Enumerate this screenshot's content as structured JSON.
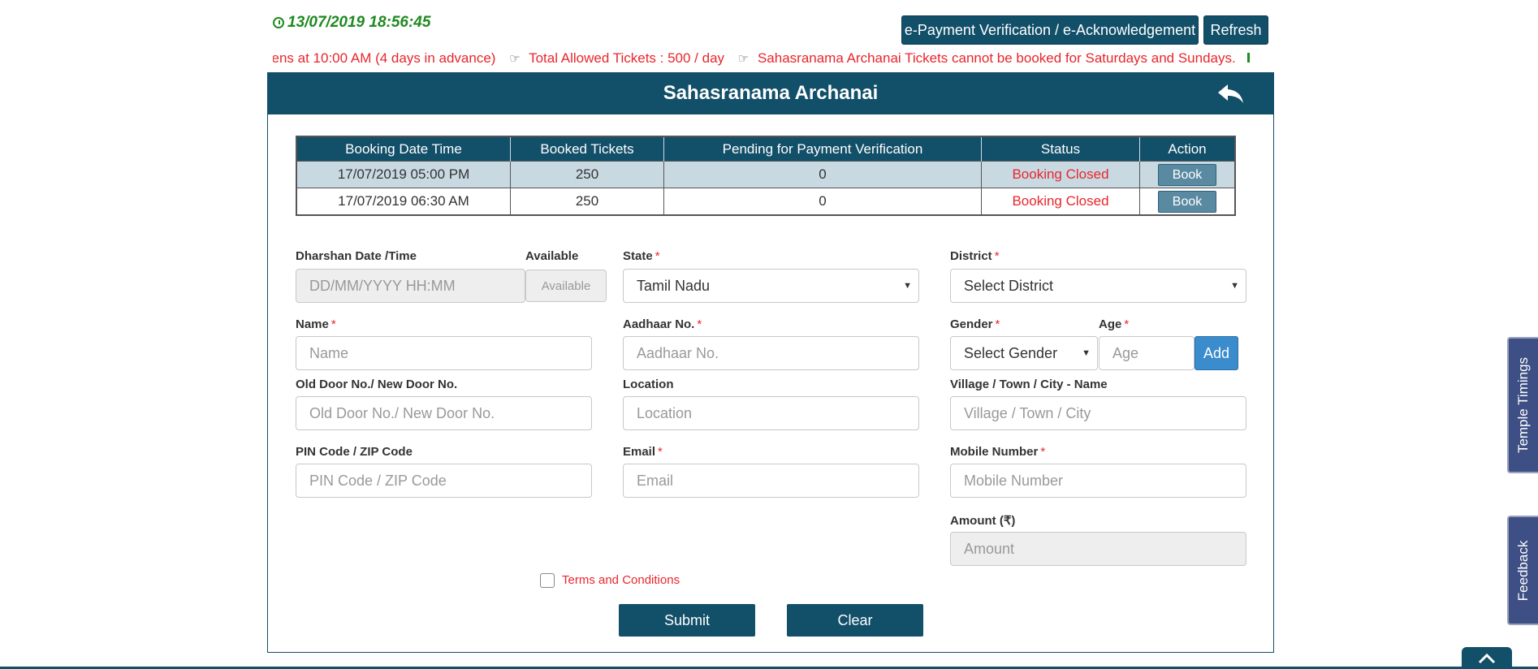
{
  "header": {
    "datetime": "13/07/2019 18:56:45",
    "epayment_label": "e-Payment Verification / e-Acknowledgement",
    "refresh_label": "Refresh",
    "ticker": [
      "ɔens at 10:00 AM (4 days in advance)",
      "Total Allowed Tickets : 500 / day",
      "Sahasranama Archanai Tickets cannot be booked for Saturdays and Sundays."
    ]
  },
  "panel": {
    "title": "Sahasranama Archanai"
  },
  "table": {
    "columns": [
      "Booking Date Time",
      "Booked Tickets",
      "Pending for Payment Verification",
      "Status",
      "Action"
    ],
    "rows": [
      {
        "datetime": "17/07/2019 05:00 PM",
        "booked": "250",
        "pending": "0",
        "status": "Booking Closed",
        "action": "Book"
      },
      {
        "datetime": "17/07/2019 06:30 AM",
        "booked": "250",
        "pending": "0",
        "status": "Booking Closed",
        "action": "Book"
      }
    ]
  },
  "form": {
    "dharshan_label": "Dharshan Date /Time",
    "dharshan_placeholder": "DD/MM/YYYY HH:MM",
    "available_label": "Available",
    "available_value": "Available",
    "state_label": "State",
    "state_value": "Tamil Nadu",
    "district_label": "District",
    "district_value": "Select District",
    "name_label": "Name",
    "name_placeholder": "Name",
    "aadhaar_label": "Aadhaar No.",
    "aadhaar_placeholder": "Aadhaar No.",
    "gender_label": "Gender",
    "gender_value": "Select Gender",
    "age_label": "Age",
    "age_placeholder": "Age",
    "add_label": "Add",
    "door_label": "Old Door No./ New Door No.",
    "door_placeholder": "Old Door No./ New Door No.",
    "location_label": "Location",
    "location_placeholder": "Location",
    "village_label": "Village / Town / City - Name",
    "village_placeholder": "Village / Town / City",
    "pin_label": "PIN Code / ZIP Code",
    "pin_placeholder": "PIN Code / ZIP Code",
    "email_label": "Email",
    "email_placeholder": "Email",
    "mobile_label": "Mobile Number",
    "mobile_placeholder": "Mobile Number",
    "amount_label": "Amount (₹)",
    "amount_placeholder": "Amount",
    "required_mark": "*",
    "terms_label": "Terms and Conditions",
    "submit_label": "Submit",
    "clear_label": "Clear"
  },
  "side": {
    "temple_timings": "Temple Timings",
    "feedback": "Feedback"
  },
  "colors": {
    "primary": "#124f69",
    "alert_red": "#e8262c",
    "clock_green": "#1f8a1f",
    "side_tab": "#3d4f84",
    "add_blue": "#3a8ccd"
  }
}
